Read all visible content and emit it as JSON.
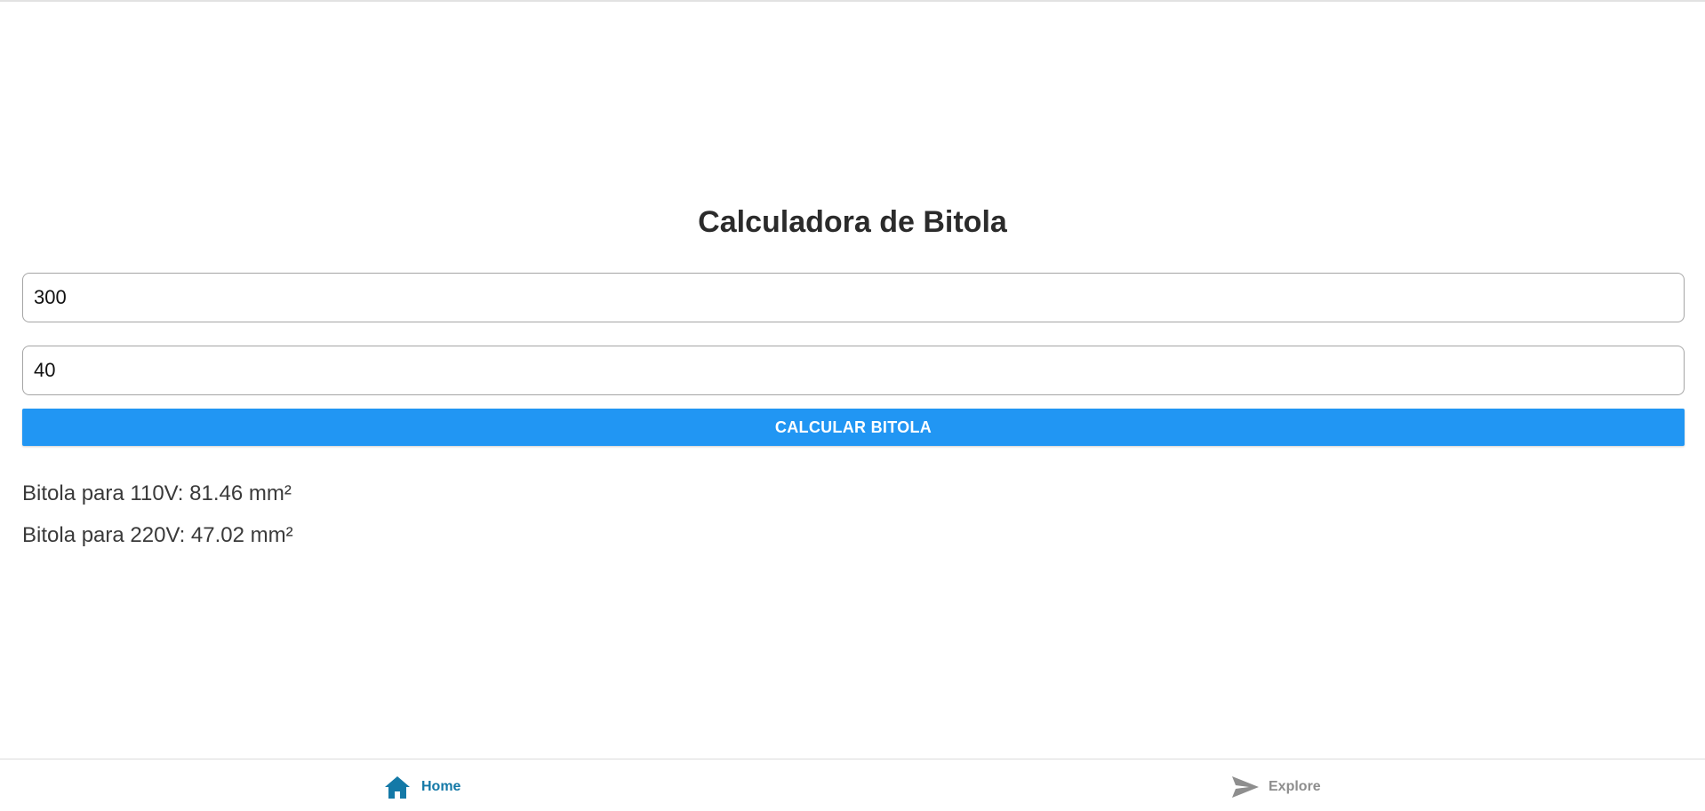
{
  "page": {
    "title": "Calculadora de Bitola"
  },
  "form": {
    "power_value": "300",
    "distance_value": "40",
    "calculate_button_label": "CALCULAR BITOLA"
  },
  "results": {
    "line_110v": "Bitola para 110V: 81.46 mm²",
    "line_220v": "Bitola para 220V: 47.02 mm²"
  },
  "tabbar": {
    "home": {
      "label": "Home",
      "icon": "home-icon",
      "color": "#1479a7",
      "active": true
    },
    "explore": {
      "label": "Explore",
      "icon": "send-icon",
      "color": "#8e8e8e",
      "active": false
    }
  },
  "colors": {
    "accent": "#2196f3",
    "active_tab": "#1479a7",
    "inactive_tab": "#8e8e8e"
  }
}
